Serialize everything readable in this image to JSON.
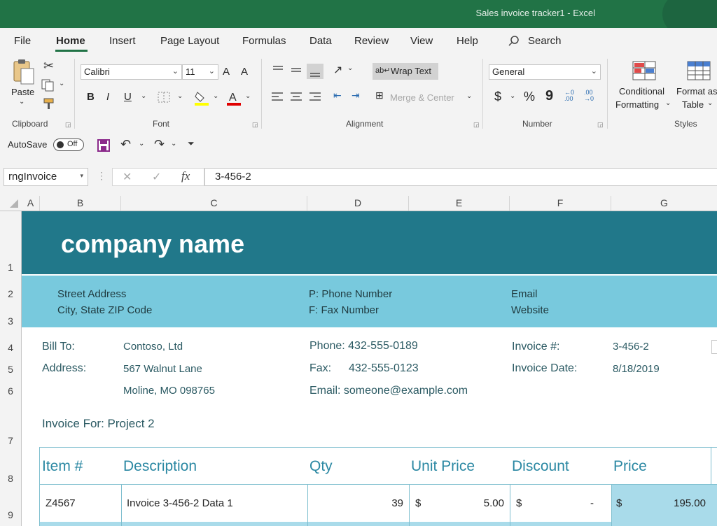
{
  "window": {
    "title": "Sales invoice tracker1  -  Excel"
  },
  "menu": {
    "tabs": [
      "File",
      "Home",
      "Insert",
      "Page Layout",
      "Formulas",
      "Data",
      "Review",
      "View",
      "Help"
    ],
    "active": "Home",
    "search": "Search"
  },
  "ribbon": {
    "clipboard": {
      "paste": "Paste",
      "label": "Clipboard"
    },
    "font": {
      "name": "Calibri",
      "size": "11",
      "label": "Font",
      "bold": "B",
      "italic": "I",
      "underline": "U",
      "grow": "A",
      "shrink": "A"
    },
    "alignment": {
      "wrap_text": "Wrap Text",
      "merge_center": "Merge & Center",
      "label": "Alignment"
    },
    "number": {
      "format": "General",
      "label": "Number",
      "currency": "$",
      "percent": "%",
      "comma": "9"
    },
    "styles": {
      "conditional": "Conditional",
      "formatting": "Formatting",
      "format_as": "Format as",
      "table": "Table",
      "label": "Styles"
    }
  },
  "qat": {
    "autosave": "AutoSave",
    "toggle": "Off"
  },
  "formula_bar": {
    "name_box": "rngInvoice",
    "fx": "fx",
    "content": "3-456-2"
  },
  "columns": [
    "A",
    "B",
    "C",
    "D",
    "E",
    "F",
    "G"
  ],
  "rows": [
    "1",
    "2",
    "3",
    "4",
    "5",
    "6",
    "7",
    "8",
    "9"
  ],
  "sheet": {
    "company": "company name",
    "street": "Street Address",
    "city": "City, State ZIP Code",
    "phone": "P: Phone Number",
    "fax": "F: Fax Number",
    "email": "Email",
    "website": "Website",
    "bill_to_label": "Bill To:",
    "bill_to": "Contoso, Ltd",
    "address_label": "Address:",
    "address1": "567 Walnut Lane",
    "address2": "Moline, MO 098765",
    "phone_line": "Phone: 432-555-0189",
    "fax_label": "Fax:",
    "fax_value": "432-555-0123",
    "email_line": "Email: someone@example.com",
    "invoice_no_label": "Invoice #:",
    "invoice_no": "3-456-2",
    "invoice_date_label": "Invoice Date:",
    "invoice_date": "8/18/2019",
    "invoice_for": "Invoice For: Project 2"
  },
  "table": {
    "headers": [
      "Item #",
      "Description",
      "Qty",
      "Unit Price",
      "Discount",
      "Price"
    ],
    "row": {
      "item": "Z4567",
      "description": "Invoice 3-456-2 Data 1",
      "qty": "39",
      "unit_currency": "$",
      "unit_price": "5.00",
      "disc_currency": "$",
      "discount": "-",
      "price_currency": "$",
      "price": "195.00"
    }
  },
  "colors": {
    "excel_green": "#217346",
    "banner": "#21788a",
    "band": "#78c9dd",
    "price_cell": "#a9dbea"
  }
}
